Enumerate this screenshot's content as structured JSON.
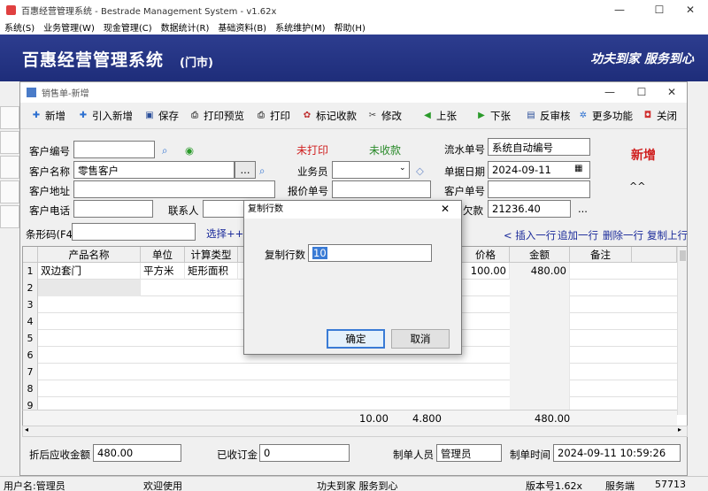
{
  "app": {
    "title": "百惠经营管理系统 - Bestrade Management System - v1.62x",
    "menu": [
      "系统(S)",
      "业务管理(W)",
      "现金管理(C)",
      "数据统计(R)",
      "基础资料(B)",
      "系统维护(M)",
      "帮助(H)"
    ],
    "banner_title": "百惠经营管理系统",
    "banner_sub": "(门市)",
    "banner_slogan": "功夫到家 服务到心",
    "win_min": "—",
    "win_max": "☐",
    "win_close": "✕"
  },
  "child": {
    "title": "销售单-新增",
    "toolbar": [
      {
        "label": "新增",
        "icon": "plus-icon",
        "glyph": "✚",
        "color": "#2b6fd0"
      },
      {
        "label": "引入新增",
        "icon": "import-add-icon",
        "glyph": "✚",
        "color": "#2b6fd0"
      },
      {
        "label": "保存",
        "icon": "save-icon",
        "glyph": "▣",
        "color": "#2b4f9a"
      },
      {
        "label": "打印预览",
        "icon": "print-preview-icon",
        "glyph": "⎙",
        "color": "#555555"
      },
      {
        "label": "打印",
        "icon": "print-icon",
        "glyph": "⎙",
        "color": "#555555"
      },
      {
        "label": "标记收款",
        "icon": "mark-paid-icon",
        "glyph": "✿",
        "color": "#c03030"
      },
      {
        "label": "修改",
        "icon": "edit-icon",
        "glyph": "✂",
        "color": "#444444"
      },
      {
        "label": "上张",
        "icon": "previous-icon",
        "glyph": "◀",
        "color": "#2a9a2a"
      },
      {
        "label": "下张",
        "icon": "next-icon",
        "glyph": "▶",
        "color": "#2a9a2a"
      },
      {
        "label": "反审核",
        "icon": "unaudit-icon",
        "glyph": "▤",
        "color": "#2b4f9a"
      },
      {
        "label": "更多功能",
        "icon": "more-functions-icon",
        "glyph": "✲",
        "color": "#2b6fd0"
      },
      {
        "label": "关闭",
        "icon": "close-icon",
        "glyph": "◘",
        "color": "#d03030"
      }
    ]
  },
  "form": {
    "customer_no_label": "客户编号",
    "customer_no": "",
    "customer_name_label": "客户名称",
    "customer_name": "零售客户",
    "ellipsis": "...",
    "customer_address_label": "客户地址",
    "customer_address": "",
    "customer_phone_label": "客户电话",
    "customer_phone": "",
    "contact_label": "联系人",
    "contact": "",
    "print_status": "未打印",
    "pay_status": "未收款",
    "salesman_label": "业务员",
    "salesman": "",
    "quote_no_label": "报价单号",
    "quote_no": "",
    "serial_label": "流水单号",
    "serial": "系统自动编号",
    "date_label": "单据日期",
    "date": "2024-09-11",
    "cust_order_label": "客户单号",
    "cust_order": "",
    "debt_label": "欠款",
    "debt": "21236.40",
    "debt_more": "...",
    "mode_badge": "新增",
    "caret": "^^"
  },
  "barcode": {
    "label": "条形码(F4)",
    "value": "",
    "select": "选择++",
    "actions": [
      "< 插入一行",
      "追加一行",
      "删除一行",
      "复制上行"
    ]
  },
  "grid": {
    "columns": [
      "产品名称",
      "单位",
      "计算类型",
      "价格",
      "金额",
      "备注"
    ],
    "row_numbers": [
      "1",
      "2",
      "3",
      "4",
      "5",
      "6",
      "7",
      "8",
      "9"
    ],
    "row1": {
      "product": "双边套门",
      "unit": "平方米",
      "calc": "矩形面积",
      "price": "100.00",
      "amount": "480.00"
    },
    "totals": {
      "qty": "10.00",
      "area": "4.800",
      "amount": "480.00"
    }
  },
  "footer": {
    "receivable_label": "折后应收金额",
    "receivable": "480.00",
    "deposit_label": "已收订金",
    "deposit": "0",
    "maker_label": "制单人员",
    "maker": "管理员",
    "make_time_label": "制单时间",
    "make_time": "2024-09-11 10:59:26"
  },
  "dialog": {
    "title": "复制行数",
    "field_label": "复制行数",
    "field_value": "10",
    "ok": "确定",
    "cancel": "取消",
    "close": "✕"
  },
  "status": {
    "user": "用户名:管理员",
    "welcome": "欢迎使用",
    "slogan": "功夫到家 服务到心",
    "version": "版本号1.62x",
    "side": "服务端",
    "code": "57713"
  }
}
